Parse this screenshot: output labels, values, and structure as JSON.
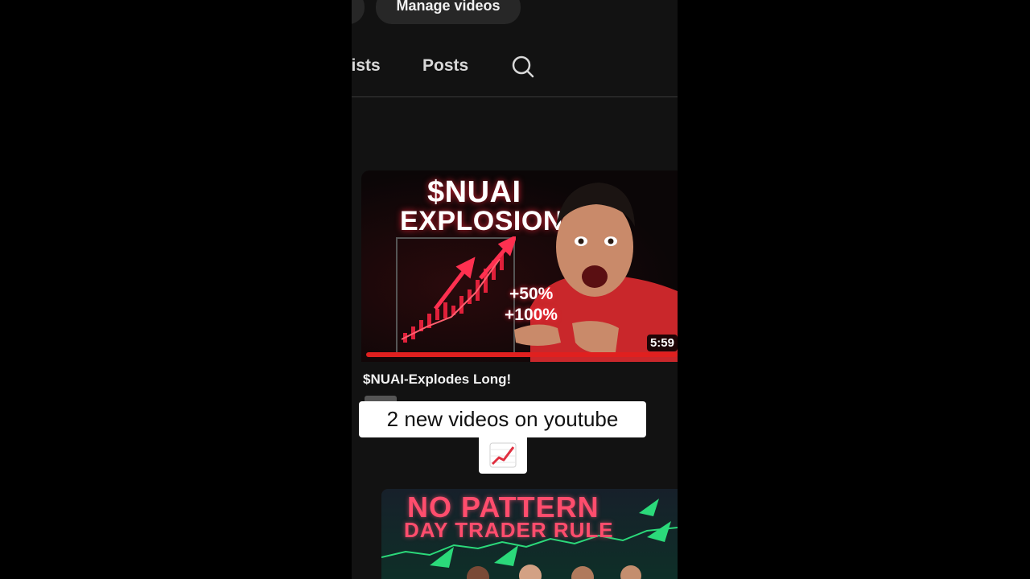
{
  "header": {
    "manage_label": "Manage videos"
  },
  "tabs": [
    {
      "label": "ylists"
    },
    {
      "label": "Posts"
    }
  ],
  "video1": {
    "thumb_title_line1": "$NUAI",
    "thumb_title_line2": "EXPLOSION",
    "badge_1": "+50%",
    "badge_2": "+100%",
    "duration": "5:59",
    "title": "$NUAI-Explodes Long!"
  },
  "caption": {
    "text": "2 new videos on youtube",
    "emoji": "📈"
  },
  "video2": {
    "thumb_line1": "NO PATTERN",
    "thumb_line2": "DAY TRADER RULE"
  },
  "colors": {
    "accent_red": "#e0201f",
    "background": "#121212",
    "pink_title": "#ff4d6d"
  }
}
